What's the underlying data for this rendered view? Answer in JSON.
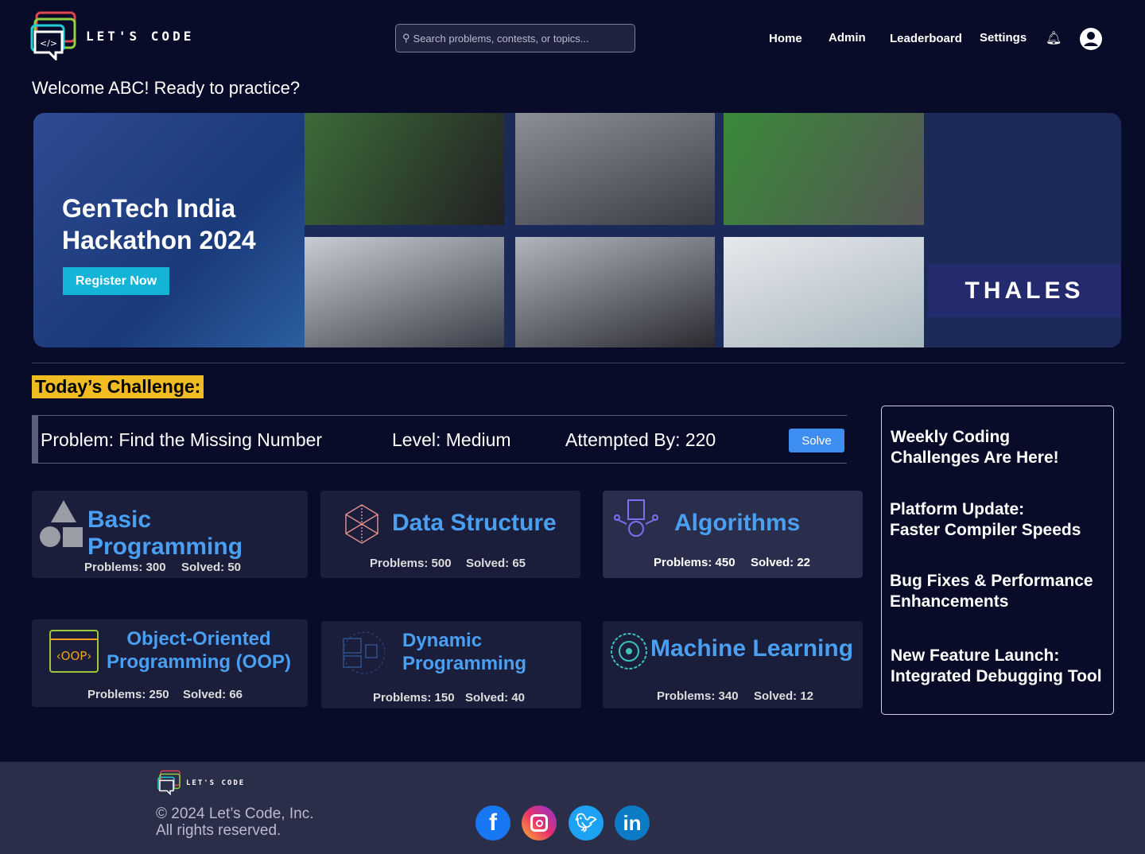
{
  "brand": {
    "name": "LET'S CODE"
  },
  "search": {
    "placeholder": "Search problems, contests, or topics..."
  },
  "nav": {
    "home": "Home",
    "admin": "Admin",
    "leaderboard": "Leaderboard",
    "settings": "Settings",
    "icons": [
      "bell-icon",
      "user-avatar-icon"
    ]
  },
  "welcome": "Welcome ABC! Ready to practice?",
  "banner": {
    "title_line1": "GenTech India",
    "title_line2": "Hackathon 2024",
    "register": "Register Now",
    "sponsor": "THALES"
  },
  "challenge": {
    "heading": "Today’s Challenge:",
    "problem": "Problem: Find the Missing Number",
    "level": "Level: Medium",
    "attempted": "Attempted By: 220",
    "solve": "Solve"
  },
  "topics": [
    {
      "title": "Basic Programming",
      "problems": "Problems: 300",
      "solved": "Solved: 50"
    },
    {
      "title": "Data Structure",
      "problems": "Problems: 500",
      "solved": "Solved: 65"
    },
    {
      "title": "Algorithms",
      "problems": "Problems: 450",
      "solved": "Solved: 22"
    },
    {
      "title_line1": "Object-Oriented",
      "title_line2": "Programming (OOP)",
      "problems": "Problems: 250",
      "solved": "Solved: 66"
    },
    {
      "title_line1": "Dynamic",
      "title_line2": "Programming",
      "problems": "Problems: 150",
      "solved": "Solved: 40"
    },
    {
      "title": "Machine Learning",
      "problems": "Problems: 340",
      "solved": "Solved: 12"
    }
  ],
  "news": [
    {
      "l1": "Weekly Coding",
      "l2": "Challenges Are Here!"
    },
    {
      "l1": "Platform Update:",
      "l2": "Faster Compiler Speeds"
    },
    {
      "l1": "Bug Fixes & Performance",
      "l2": "Enhancements"
    },
    {
      "l1": "New Feature Launch:",
      "l2": "Integrated Debugging Tool"
    }
  ],
  "footer": {
    "brand": "LET'S CODE",
    "copyright": "© 2024 Let’s Code, Inc.",
    "rights": "All rights reserved.",
    "social": [
      "facebook",
      "instagram",
      "twitter",
      "linkedin"
    ]
  }
}
